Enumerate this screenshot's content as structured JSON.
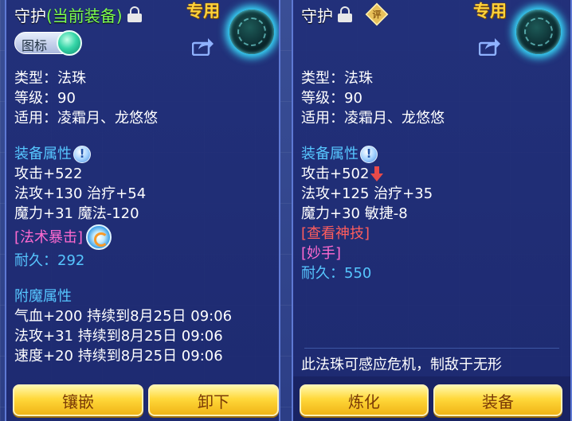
{
  "left_panel": {
    "title_prefix": "守护",
    "title_equipped": "(当前装备)",
    "special_tag": "专用",
    "icon_toggle_label": "图标",
    "type_line": "类型：法珠",
    "level_line": "等级：90",
    "applicable_line": "适用：凌霜月、龙悠悠",
    "attr_head": "装备属性",
    "attrs": [
      "攻击+522",
      "法攻+130 治疗+54",
      "魔力+31 魔法-120"
    ],
    "skill": "[法术暴击]",
    "durability_label": "耐久：",
    "durability_value": "292",
    "enchant_head": "附魔属性",
    "enchants": [
      "气血+200 持续到8月25日 09:06",
      "法攻+31 持续到8月25日 09:06",
      "速度+20 持续到8月25日 09:06"
    ],
    "btn1": "镶嵌",
    "btn2": "卸下"
  },
  "right_panel": {
    "title_prefix": "守护",
    "ping_label": "评",
    "special_tag": "专用",
    "type_line": "类型：法珠",
    "level_line": "等级：90",
    "applicable_line": "适用：凌霜月、龙悠悠",
    "attr_head": "装备属性",
    "attr1": "攻击+502",
    "attrs": [
      "法攻+125 治疗+35",
      "魔力+30 敏捷-8"
    ],
    "view_skill": "[查看神技]",
    "skill": "[妙手]",
    "durability_label": "耐久：",
    "durability_value": "550",
    "description": "此法珠可感应危机，制敌于无形",
    "btn1": "炼化",
    "btn2": "装备"
  },
  "colors": {
    "equipped_green": "#7dff4f",
    "section_blue": "#56c6ff",
    "skill_pink": "#ff6ad0",
    "link_red": "#ff5d5d",
    "tag_gold": "#ffd23a"
  },
  "icons": [
    "lock-icon",
    "ping-icon",
    "orb-icon",
    "share-icon",
    "info-icon",
    "down-arrow-icon",
    "spell-icon"
  ]
}
